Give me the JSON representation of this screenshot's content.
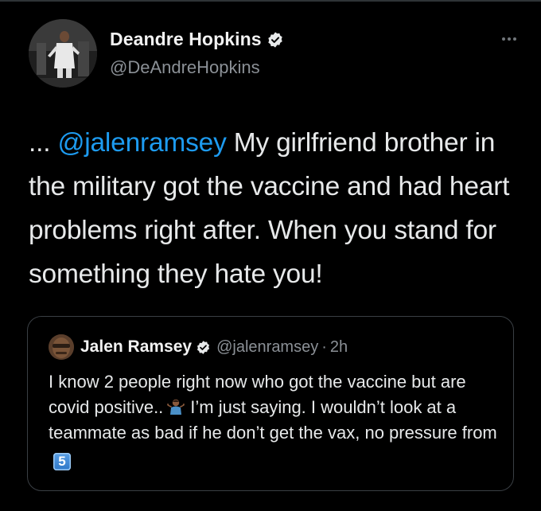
{
  "tweet": {
    "author": {
      "display_name": "Deandre Hopkins",
      "handle": "@DeAndreHopkins",
      "verified_icon": "verified-badge-icon"
    },
    "more_icon": "more-options-icon",
    "text_prefix": "... ",
    "mention": "@jalenramsey",
    "text_body": " My girlfriend brother in the military got the vaccine and had heart problems right after. When you stand for something they hate you!"
  },
  "quoted_tweet": {
    "author": {
      "display_name": "Jalen Ramsey",
      "handle": "@jalenramsey",
      "separator": "·",
      "timestamp": "2h",
      "verified_icon": "verified-badge-icon"
    },
    "text_part1": "I know 2 people right now who got the vaccine but are covid positive..",
    "emoji_1": "person-shrugging-emoji",
    "text_part2": "I’m just saying. I wouldn’t look at a teammate as bad if he don’t get the vax, no pressure from",
    "emoji_2_label": "5",
    "emoji_2": "keycap-five-emoji"
  },
  "colors": {
    "background": "#000000",
    "text": "#e7e9ea",
    "secondary_text": "#8b9096",
    "mention": "#1d9bf0",
    "verified": "#e7e9ea",
    "border": "#3a3f44"
  }
}
